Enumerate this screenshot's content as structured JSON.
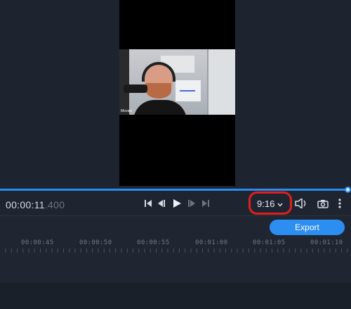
{
  "player": {
    "timecode_main": "00:00:11",
    "timecode_ms": ".400",
    "aspect_ratio": "9:16",
    "progress": 0.99,
    "video_overlay_text": "Movavi"
  },
  "toolbar": {
    "export_label": "Export"
  },
  "timeline": {
    "ruler_labels": [
      "00:00:45",
      "00:00:50",
      "00:00:55",
      "00:01:00",
      "00:01:05",
      "00:01:10"
    ]
  },
  "icons": {
    "skip_start": "skip-to-start-icon",
    "prev_frame": "previous-frame-icon",
    "play": "play-icon",
    "next_frame": "next-frame-icon",
    "skip_end": "skip-to-end-icon",
    "volume": "volume-icon",
    "snapshot": "camera-icon",
    "more": "more-vertical-icon",
    "dropdown": "chevron-down-icon"
  },
  "colors": {
    "accent": "#2b8cf0",
    "highlight_ring": "#e11f1f",
    "background": "#1e2530"
  }
}
